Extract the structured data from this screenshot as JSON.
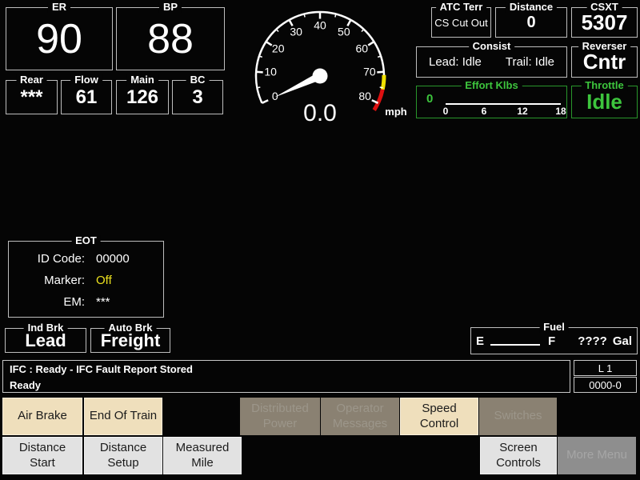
{
  "pressures": {
    "er": {
      "label": "ER",
      "value": "90"
    },
    "bp": {
      "label": "BP",
      "value": "88"
    },
    "rear": {
      "label": "Rear",
      "value": "***"
    },
    "flow": {
      "label": "Flow",
      "value": "61"
    },
    "main": {
      "label": "Main",
      "value": "126"
    },
    "bc": {
      "label": "BC",
      "value": "3"
    }
  },
  "chart_data": {
    "type": "gauge",
    "title": "speedometer",
    "min": 0,
    "max": 80,
    "major_tick_step": 10,
    "minor_tick_step": 5,
    "tick_labels": [
      "0",
      "10",
      "20",
      "30",
      "40",
      "50",
      "60",
      "70",
      "80"
    ],
    "value": 0.0,
    "display": "0.0",
    "units": "mph",
    "start_angle": 205,
    "end_angle": -25,
    "yellow_zone": [
      71,
      75.5
    ],
    "red_zone": [
      75.5,
      82.5
    ]
  },
  "top_right": {
    "atc_terr": {
      "label": "ATC Terr",
      "value": "CS Cut Out"
    },
    "distance": {
      "label": "Distance",
      "value": "0"
    },
    "unit": {
      "label": "CSXT",
      "value": "5307"
    },
    "consist": {
      "label": "Consist",
      "lead": "Lead: Idle",
      "trail": "Trail: Idle"
    },
    "reverser": {
      "label": "Reverser",
      "value": "Cntr"
    },
    "effort": {
      "label": "Effort Klbs",
      "value": "0",
      "scale_ticks": [
        "0",
        "6",
        "12",
        "18"
      ]
    },
    "throttle": {
      "label": "Throttle",
      "value": "Idle"
    }
  },
  "eot": {
    "label": "EOT",
    "id_code": {
      "label": "ID Code:",
      "value": "00000"
    },
    "marker": {
      "label": "Marker:",
      "value": "Off"
    },
    "em": {
      "label": "EM:",
      "value": "***"
    }
  },
  "brakes": {
    "ind": {
      "label": "Ind Brk",
      "value": "Lead"
    },
    "auto": {
      "label": "Auto Brk",
      "value": "Freight"
    }
  },
  "fuel": {
    "label": "Fuel",
    "empty": "E",
    "full": "F",
    "value": "????",
    "units": "Gal"
  },
  "status": {
    "line1": "IFC : Ready - IFC Fault Report Stored",
    "line2": "Ready",
    "cell_top": "L 1",
    "cell_bottom": "0000-0"
  },
  "menu": {
    "row1": [
      {
        "label": "Air Brake",
        "enabled": true
      },
      {
        "label": "End Of Train",
        "enabled": true
      },
      {
        "label": "Distributed Power",
        "enabled": false
      },
      {
        "label": "Operator Messages",
        "enabled": false
      },
      {
        "label": "Speed Control",
        "enabled": true
      },
      {
        "label": "Switches",
        "enabled": false
      }
    ],
    "row2": [
      {
        "label": "Distance Start",
        "enabled": true
      },
      {
        "label": "Distance Setup",
        "enabled": true
      },
      {
        "label": "Measured Mile",
        "enabled": true
      },
      {
        "label": "Screen Controls",
        "enabled": true
      },
      {
        "label": "More Menu",
        "enabled": false
      }
    ]
  },
  "colors": {
    "green_text": "#3dc53d",
    "green_border": "#28962b",
    "marker_yellow": "#ece11e",
    "gauge_yellow": "#f0e000",
    "gauge_red": "#dd1111",
    "enabled_tan": "#efdfbc",
    "enabled_gray": "#e2e2e2",
    "disabled_taupe": "#8a8172",
    "disabled_gray": "#8e8e8e"
  }
}
